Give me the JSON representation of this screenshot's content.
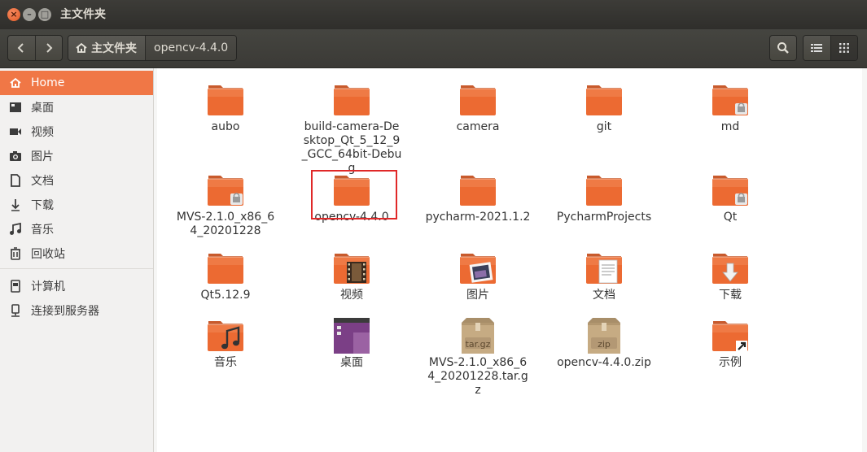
{
  "window": {
    "title": "主文件夹",
    "close_glyph": "×",
    "min_glyph": "–",
    "max_glyph": "□"
  },
  "breadcrumb": {
    "home": "主文件夹",
    "current": "opencv-4.4.0"
  },
  "sidebar": {
    "items": [
      {
        "label": "Home",
        "icon": "home-icon",
        "active": true
      },
      {
        "label": "桌面",
        "icon": "desktop-icon"
      },
      {
        "label": "视频",
        "icon": "video-icon"
      },
      {
        "label": "图片",
        "icon": "camera-icon"
      },
      {
        "label": "文档",
        "icon": "document-icon"
      },
      {
        "label": "下载",
        "icon": "download-icon"
      },
      {
        "label": "音乐",
        "icon": "music-icon"
      },
      {
        "label": "回收站",
        "icon": "trash-icon"
      },
      {
        "label": "计算机",
        "icon": "computer-icon"
      },
      {
        "label": "连接到服务器",
        "icon": "server-icon"
      }
    ]
  },
  "files": [
    {
      "name": "aubo",
      "icon": "folder"
    },
    {
      "name": "build-camera-Desktop_Qt_5_12_9_GCC_64bit-Debug",
      "icon": "folder"
    },
    {
      "name": "camera",
      "icon": "folder"
    },
    {
      "name": "git",
      "icon": "folder"
    },
    {
      "name": "md",
      "icon": "folder-locked"
    },
    {
      "name": "MVS-2.1.0_x86_64_20201228",
      "icon": "folder-locked"
    },
    {
      "name": "opencv-4.4.0",
      "icon": "folder"
    },
    {
      "name": "pycharm-2021.1.2",
      "icon": "folder"
    },
    {
      "name": "PycharmProjects",
      "icon": "folder"
    },
    {
      "name": "Qt",
      "icon": "folder-locked"
    },
    {
      "name": "Qt5.12.9",
      "icon": "folder"
    },
    {
      "name": "视频",
      "icon": "folder-video"
    },
    {
      "name": "图片",
      "icon": "folder-pictures"
    },
    {
      "name": "文档",
      "icon": "folder-documents"
    },
    {
      "name": "下载",
      "icon": "folder-download"
    },
    {
      "name": "音乐",
      "icon": "folder-music"
    },
    {
      "name": "桌面",
      "icon": "folder-desktop"
    },
    {
      "name": "MVS-2.1.0_x86_64_20201228.tar.gz",
      "icon": "archive-targz",
      "badge": "tar.gz"
    },
    {
      "name": "opencv-4.4.0.zip",
      "icon": "archive-zip",
      "badge": "zip"
    },
    {
      "name": "示例",
      "icon": "folder-link"
    }
  ],
  "colors": {
    "accent": "#f07746",
    "folder": "#e95a1f",
    "selection_box": "#e02828"
  }
}
